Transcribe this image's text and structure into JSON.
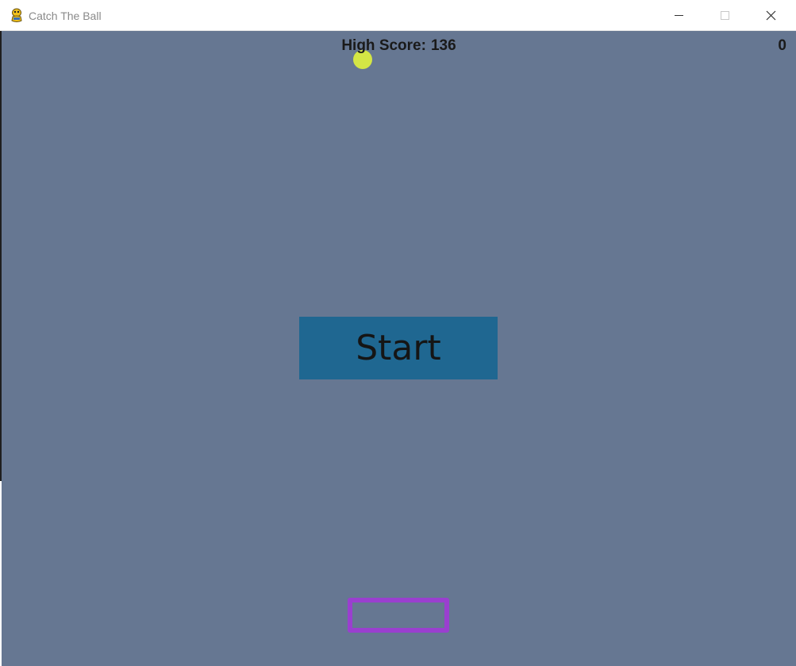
{
  "window": {
    "title": "Catch The Ball",
    "app_icon": "pygame-snake-icon",
    "controls": {
      "minimize_icon": "minimize-icon",
      "maximize_icon": "maximize-icon",
      "close_icon": "close-icon"
    }
  },
  "game": {
    "background_color": "#667792",
    "high_score_label": "High Score:",
    "high_score_value": "136",
    "current_score": "0",
    "start_label": "Start",
    "start_button_color": "#1f6791",
    "ball_color": "#d4e645",
    "paddle_color": "#9a3fcf"
  }
}
